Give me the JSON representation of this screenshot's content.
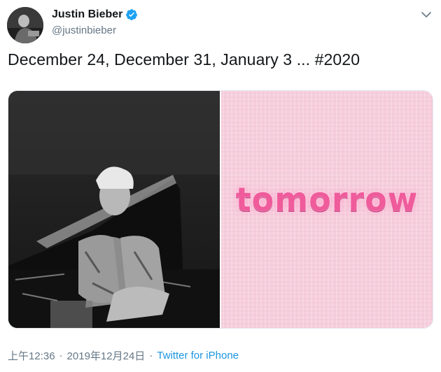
{
  "author": {
    "display_name": "Justin Bieber",
    "handle": "@justinbieber",
    "verified": true
  },
  "tweet": {
    "text": "December 24, December 31, January 3 ... #2020"
  },
  "media": {
    "right_image_text": "tomorrow"
  },
  "meta": {
    "time": "上午12:36",
    "separator": "·",
    "date": "2019年12月24日",
    "source": "Twitter for iPhone"
  },
  "colors": {
    "verified_badge": "#1da1f2",
    "link": "#1b95e0",
    "secondary_text": "#657786",
    "tomorrow_pink": "#ef5b9b"
  },
  "icons": {
    "verified": "verified-badge-icon",
    "caret": "chevron-down-icon"
  }
}
